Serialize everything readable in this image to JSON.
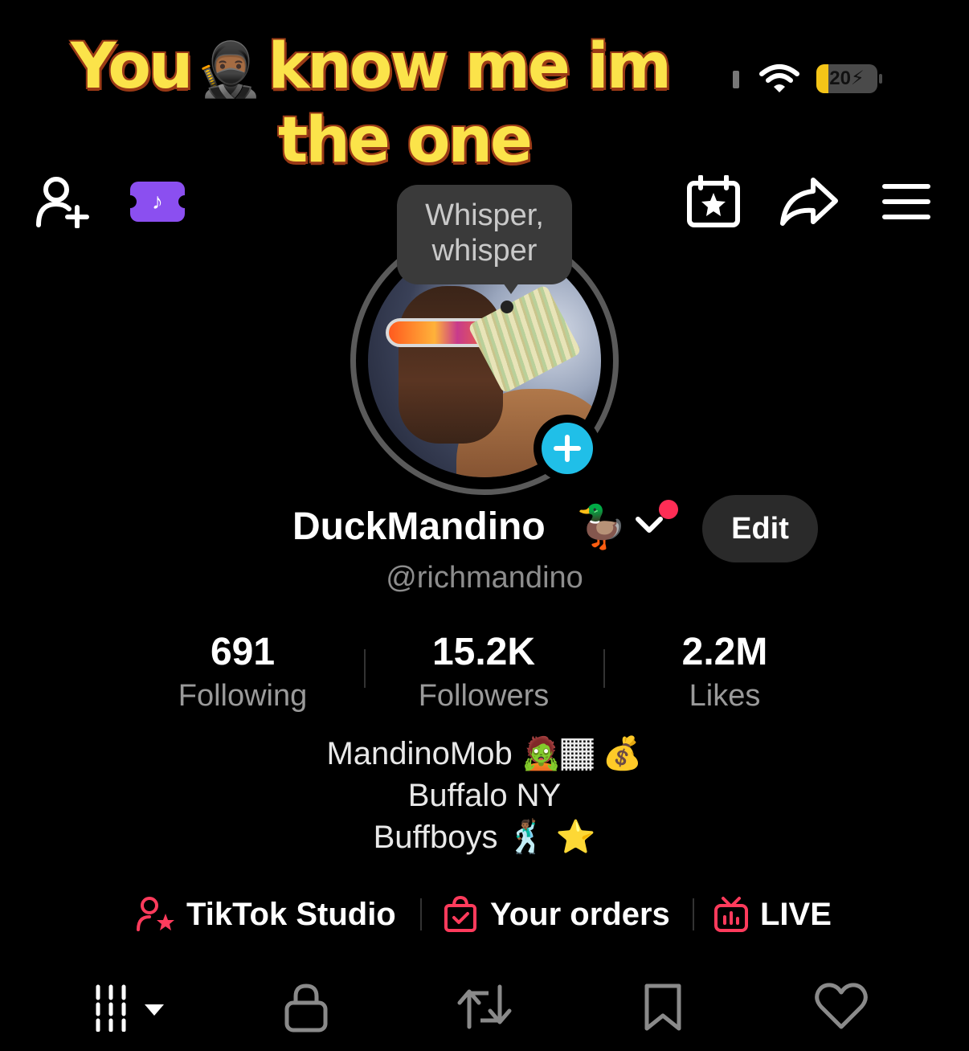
{
  "overlay": {
    "caption_line1_a": "You",
    "caption_emoji": "🥷🏾",
    "caption_line1_b": "know me im",
    "caption_line2": "the one"
  },
  "status_bar": {
    "battery_text": "20",
    "battery_level_percent": 20,
    "battery_color": "#f5c518",
    "icons": [
      "cellular-signal-icon",
      "wifi-icon",
      "battery-charging-icon"
    ]
  },
  "toolbar": {
    "left_icons": [
      "add-friend-icon",
      "tiktok-coins-ticket-icon"
    ],
    "right_icons": [
      "calendar-star-icon",
      "share-arrow-icon",
      "menu-hamburger-icon"
    ],
    "ticket_glyph": "♪"
  },
  "tooltip": {
    "line1": "Whisper,",
    "line2": "whisper"
  },
  "profile": {
    "display_name": "DuckMandino",
    "name_emoji": "🦆",
    "handle": "@richmandino",
    "edit_label": "Edit",
    "accent_add_color": "#20bfe8",
    "notification_dot_color": "#ff2d55"
  },
  "stats": [
    {
      "value": "691",
      "label": "Following"
    },
    {
      "value": "15.2K",
      "label": "Followers"
    },
    {
      "value": "2.2M",
      "label": "Likes"
    }
  ],
  "bio": {
    "line1": "MandinoMob 🧟🏾 💰",
    "line2": "Buffalo NY",
    "line3": "Buffboys 🕺🏾 ⭐"
  },
  "links": [
    {
      "label": "TikTok Studio",
      "icon": "creator-star-icon"
    },
    {
      "label": "Your orders",
      "icon": "shopping-bag-icon"
    },
    {
      "label": "LIVE",
      "icon": "live-tv-icon"
    }
  ],
  "link_accent_color": "#ff3b5c",
  "tabs": [
    "videos-grid-icon",
    "private-lock-icon",
    "reposts-icon",
    "favorites-bookmark-icon",
    "liked-heart-icon"
  ]
}
